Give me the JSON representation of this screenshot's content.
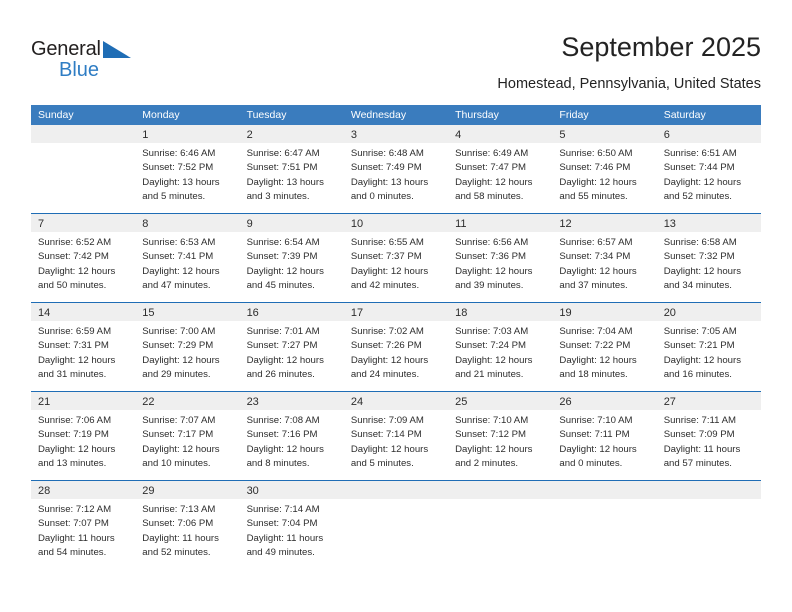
{
  "logo": {
    "text_top": "General",
    "text_bottom": "Blue",
    "triangle_color": "#1f6db5",
    "blue_color": "#2f7dc4"
  },
  "header": {
    "title": "September 2025",
    "subtitle": "Homestead, Pennsylvania, United States"
  },
  "theme": {
    "header_bg": "#3a7cbe",
    "row_divider": "#1f6db5",
    "daynum_band": "#efefef",
    "text": "#2d2d2d"
  },
  "calendar": {
    "day_headers": [
      "Sunday",
      "Monday",
      "Tuesday",
      "Wednesday",
      "Thursday",
      "Friday",
      "Saturday"
    ],
    "weeks": [
      [
        {
          "day": "",
          "lines": []
        },
        {
          "day": "1",
          "lines": [
            "Sunrise: 6:46 AM",
            "Sunset: 7:52 PM",
            "Daylight: 13 hours",
            "and 5 minutes."
          ]
        },
        {
          "day": "2",
          "lines": [
            "Sunrise: 6:47 AM",
            "Sunset: 7:51 PM",
            "Daylight: 13 hours",
            "and 3 minutes."
          ]
        },
        {
          "day": "3",
          "lines": [
            "Sunrise: 6:48 AM",
            "Sunset: 7:49 PM",
            "Daylight: 13 hours",
            "and 0 minutes."
          ]
        },
        {
          "day": "4",
          "lines": [
            "Sunrise: 6:49 AM",
            "Sunset: 7:47 PM",
            "Daylight: 12 hours",
            "and 58 minutes."
          ]
        },
        {
          "day": "5",
          "lines": [
            "Sunrise: 6:50 AM",
            "Sunset: 7:46 PM",
            "Daylight: 12 hours",
            "and 55 minutes."
          ]
        },
        {
          "day": "6",
          "lines": [
            "Sunrise: 6:51 AM",
            "Sunset: 7:44 PM",
            "Daylight: 12 hours",
            "and 52 minutes."
          ]
        }
      ],
      [
        {
          "day": "7",
          "lines": [
            "Sunrise: 6:52 AM",
            "Sunset: 7:42 PM",
            "Daylight: 12 hours",
            "and 50 minutes."
          ]
        },
        {
          "day": "8",
          "lines": [
            "Sunrise: 6:53 AM",
            "Sunset: 7:41 PM",
            "Daylight: 12 hours",
            "and 47 minutes."
          ]
        },
        {
          "day": "9",
          "lines": [
            "Sunrise: 6:54 AM",
            "Sunset: 7:39 PM",
            "Daylight: 12 hours",
            "and 45 minutes."
          ]
        },
        {
          "day": "10",
          "lines": [
            "Sunrise: 6:55 AM",
            "Sunset: 7:37 PM",
            "Daylight: 12 hours",
            "and 42 minutes."
          ]
        },
        {
          "day": "11",
          "lines": [
            "Sunrise: 6:56 AM",
            "Sunset: 7:36 PM",
            "Daylight: 12 hours",
            "and 39 minutes."
          ]
        },
        {
          "day": "12",
          "lines": [
            "Sunrise: 6:57 AM",
            "Sunset: 7:34 PM",
            "Daylight: 12 hours",
            "and 37 minutes."
          ]
        },
        {
          "day": "13",
          "lines": [
            "Sunrise: 6:58 AM",
            "Sunset: 7:32 PM",
            "Daylight: 12 hours",
            "and 34 minutes."
          ]
        }
      ],
      [
        {
          "day": "14",
          "lines": [
            "Sunrise: 6:59 AM",
            "Sunset: 7:31 PM",
            "Daylight: 12 hours",
            "and 31 minutes."
          ]
        },
        {
          "day": "15",
          "lines": [
            "Sunrise: 7:00 AM",
            "Sunset: 7:29 PM",
            "Daylight: 12 hours",
            "and 29 minutes."
          ]
        },
        {
          "day": "16",
          "lines": [
            "Sunrise: 7:01 AM",
            "Sunset: 7:27 PM",
            "Daylight: 12 hours",
            "and 26 minutes."
          ]
        },
        {
          "day": "17",
          "lines": [
            "Sunrise: 7:02 AM",
            "Sunset: 7:26 PM",
            "Daylight: 12 hours",
            "and 24 minutes."
          ]
        },
        {
          "day": "18",
          "lines": [
            "Sunrise: 7:03 AM",
            "Sunset: 7:24 PM",
            "Daylight: 12 hours",
            "and 21 minutes."
          ]
        },
        {
          "day": "19",
          "lines": [
            "Sunrise: 7:04 AM",
            "Sunset: 7:22 PM",
            "Daylight: 12 hours",
            "and 18 minutes."
          ]
        },
        {
          "day": "20",
          "lines": [
            "Sunrise: 7:05 AM",
            "Sunset: 7:21 PM",
            "Daylight: 12 hours",
            "and 16 minutes."
          ]
        }
      ],
      [
        {
          "day": "21",
          "lines": [
            "Sunrise: 7:06 AM",
            "Sunset: 7:19 PM",
            "Daylight: 12 hours",
            "and 13 minutes."
          ]
        },
        {
          "day": "22",
          "lines": [
            "Sunrise: 7:07 AM",
            "Sunset: 7:17 PM",
            "Daylight: 12 hours",
            "and 10 minutes."
          ]
        },
        {
          "day": "23",
          "lines": [
            "Sunrise: 7:08 AM",
            "Sunset: 7:16 PM",
            "Daylight: 12 hours",
            "and 8 minutes."
          ]
        },
        {
          "day": "24",
          "lines": [
            "Sunrise: 7:09 AM",
            "Sunset: 7:14 PM",
            "Daylight: 12 hours",
            "and 5 minutes."
          ]
        },
        {
          "day": "25",
          "lines": [
            "Sunrise: 7:10 AM",
            "Sunset: 7:12 PM",
            "Daylight: 12 hours",
            "and 2 minutes."
          ]
        },
        {
          "day": "26",
          "lines": [
            "Sunrise: 7:10 AM",
            "Sunset: 7:11 PM",
            "Daylight: 12 hours",
            "and 0 minutes."
          ]
        },
        {
          "day": "27",
          "lines": [
            "Sunrise: 7:11 AM",
            "Sunset: 7:09 PM",
            "Daylight: 11 hours",
            "and 57 minutes."
          ]
        }
      ],
      [
        {
          "day": "28",
          "lines": [
            "Sunrise: 7:12 AM",
            "Sunset: 7:07 PM",
            "Daylight: 11 hours",
            "and 54 minutes."
          ]
        },
        {
          "day": "29",
          "lines": [
            "Sunrise: 7:13 AM",
            "Sunset: 7:06 PM",
            "Daylight: 11 hours",
            "and 52 minutes."
          ]
        },
        {
          "day": "30",
          "lines": [
            "Sunrise: 7:14 AM",
            "Sunset: 7:04 PM",
            "Daylight: 11 hours",
            "and 49 minutes."
          ]
        },
        {
          "day": "",
          "lines": []
        },
        {
          "day": "",
          "lines": []
        },
        {
          "day": "",
          "lines": []
        },
        {
          "day": "",
          "lines": []
        }
      ]
    ]
  }
}
